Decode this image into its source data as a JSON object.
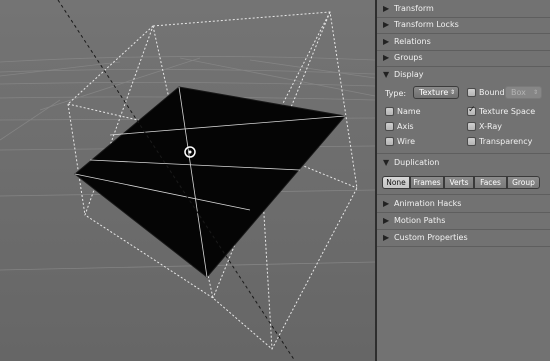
{
  "panel": {
    "sections_top": [
      {
        "label": "Transform",
        "expanded": false
      },
      {
        "label": "Transform Locks",
        "expanded": false
      },
      {
        "label": "Relations",
        "expanded": false
      },
      {
        "label": "Groups",
        "expanded": false
      }
    ],
    "display": {
      "label": "Display",
      "type_label": "Type:",
      "type_value": "Texture",
      "bound_label": "Bound",
      "bound_value": "Box",
      "checks": {
        "name": {
          "label": "Name",
          "checked": false
        },
        "texture_space": {
          "label": "Texture Space",
          "checked": true
        },
        "axis": {
          "label": "Axis",
          "checked": false
        },
        "xray": {
          "label": "X-Ray",
          "checked": false
        },
        "wire": {
          "label": "Wire",
          "checked": false
        },
        "transparency": {
          "label": "Transparency",
          "checked": false
        }
      }
    },
    "duplication": {
      "label": "Duplication",
      "options": [
        "None",
        "Frames",
        "Verts",
        "Faces",
        "Group"
      ],
      "active": "None"
    },
    "sections_bottom": [
      {
        "label": "Animation Hacks",
        "expanded": false
      },
      {
        "label": "Motion Paths",
        "expanded": false
      },
      {
        "label": "Custom Properties",
        "expanded": false
      }
    ]
  },
  "icons": {
    "collapsed": "▶",
    "expanded": "▼",
    "check": "✓",
    "updown": "▲▼"
  },
  "colors": {
    "viewport_bg": "#6e6e6e",
    "panel_bg": "#727272",
    "mesh": "#050505",
    "active_button": "#d0d0d0"
  }
}
